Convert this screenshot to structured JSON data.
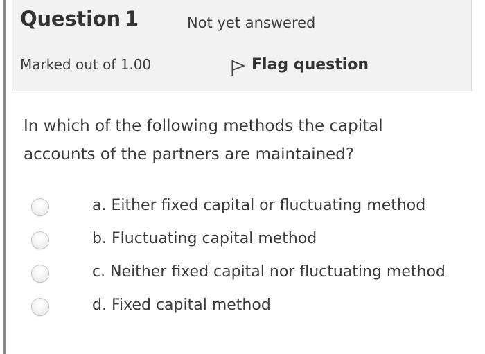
{
  "question": {
    "title_word": "Question",
    "number": "1",
    "state": "Not yet answered",
    "grade": "Marked out of 1.00",
    "flag_label": "Flag question",
    "text": "In which of the following methods the capital accounts of the partners are maintained?",
    "flag_icon": "flag-outline-icon"
  },
  "answers": [
    {
      "label": "a. Either fixed capital or fluctuating method",
      "selected": false
    },
    {
      "label": "b. Fluctuating capital method",
      "selected": false
    },
    {
      "label": "c. Neither fixed capital nor fluctuating method",
      "selected": false
    },
    {
      "label": "d. Fixed capital method",
      "selected": false
    }
  ],
  "colors": {
    "info_background": "#f2f2f2",
    "left_rule": "#8a8a8a",
    "text": "#3a3a3a"
  }
}
